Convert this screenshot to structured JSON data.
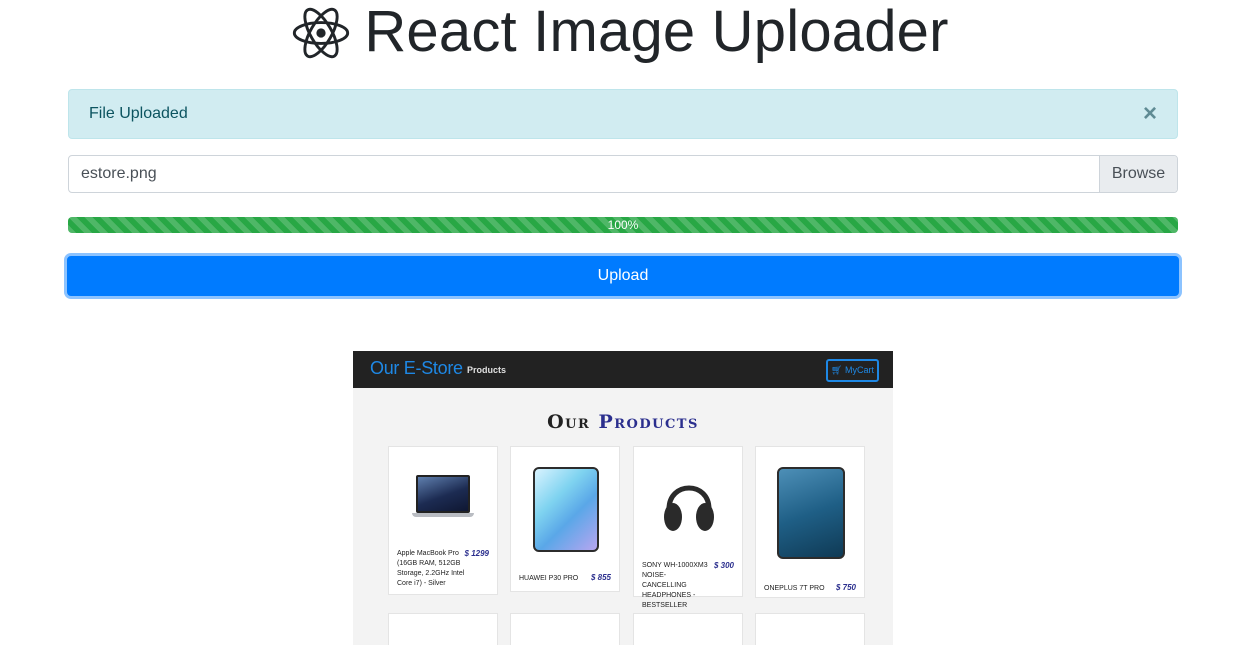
{
  "header": {
    "title": "React Image Uploader",
    "logo_icon": "react-atom-icon"
  },
  "alert": {
    "message": "File Uploaded",
    "close_label": "×"
  },
  "file_input": {
    "filename": "estore.png",
    "browse_label": "Browse"
  },
  "progress": {
    "value": 100,
    "label": "100%",
    "color": "#28a745"
  },
  "upload": {
    "label": "Upload",
    "color": "#007bff"
  },
  "preview": {
    "brand": "Our E-Store",
    "nav_link": "Products",
    "cart_label": "MyCart",
    "heading_word1": "Our",
    "heading_word2": "Products",
    "products": [
      {
        "name": "Apple MacBook Pro (16GB RAM, 512GB Storage, 2.2GHz Intel Core i7) - Silver",
        "price": "$ 1299"
      },
      {
        "name": "HUAWEI P30 PRO",
        "price": "$ 855"
      },
      {
        "name": "SONY WH-1000XM3 NOISE-CANCELLING HEADPHONES - BESTSELLER",
        "price": "$ 300"
      },
      {
        "name": "ONEPLUS 7T PRO",
        "price": "$ 750"
      }
    ]
  }
}
